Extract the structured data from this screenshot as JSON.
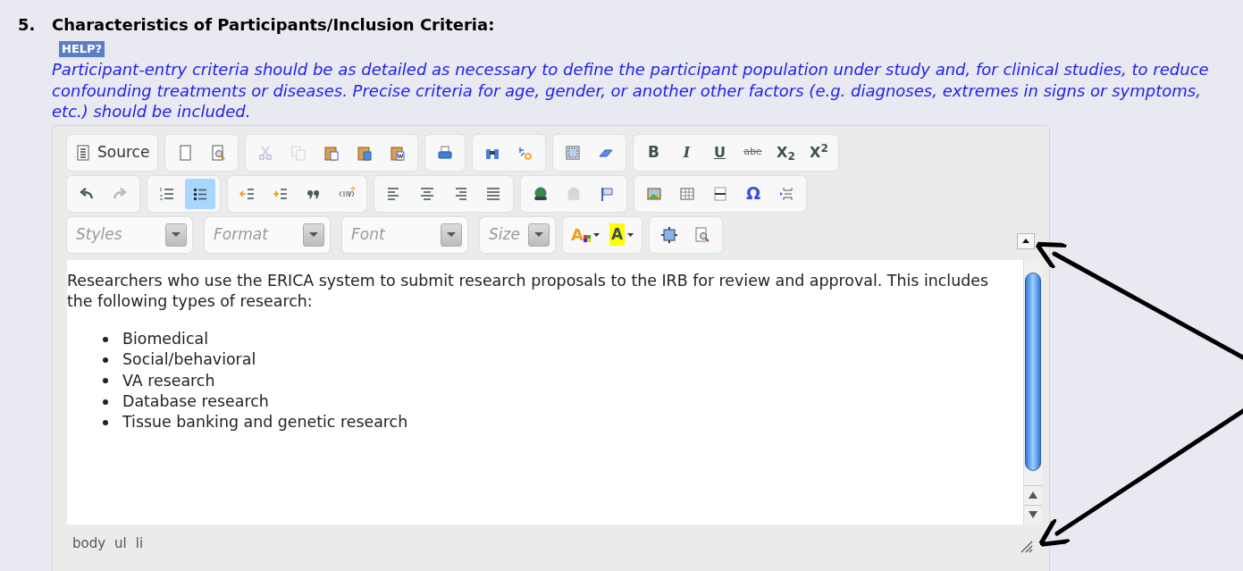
{
  "question": {
    "number": "5.",
    "title": "Characteristics of Participants/Inclusion Criteria:",
    "help": "HELP?",
    "instructions": "Participant-entry criteria should be as detailed as necessary to define the participant population under study and, for clinical studies, to reduce confounding treatments or diseases. Precise criteria for age, gender, or another other factors (e.g. diagnoses, extremes in signs or symptoms, etc.) should be included."
  },
  "editor": {
    "toolbar": [
      [
        [
          {
            "kind": "source",
            "label": "Source",
            "disabled": false,
            "selected": false
          }
        ],
        [
          {
            "kind": "newpage",
            "disabled": false,
            "selected": false
          },
          {
            "kind": "preview",
            "disabled": false,
            "selected": false
          }
        ],
        [
          {
            "kind": "cut",
            "disabled": true,
            "selected": false
          },
          {
            "kind": "copy",
            "disabled": true,
            "selected": false
          },
          {
            "kind": "paste",
            "disabled": false,
            "selected": false
          },
          {
            "kind": "pastetext",
            "disabled": false,
            "selected": false
          },
          {
            "kind": "pasteword",
            "disabled": false,
            "selected": false
          }
        ],
        [
          {
            "kind": "print",
            "disabled": false,
            "selected": false
          }
        ],
        [
          {
            "kind": "find",
            "disabled": false,
            "selected": false
          },
          {
            "kind": "replace",
            "disabled": false,
            "selected": false
          }
        ],
        [
          {
            "kind": "selectall",
            "disabled": false,
            "selected": false
          },
          {
            "kind": "eraser",
            "disabled": false,
            "selected": false
          }
        ],
        [
          {
            "kind": "bold",
            "label": "B",
            "disabled": false,
            "selected": false
          },
          {
            "kind": "italic",
            "label": "I",
            "disabled": false,
            "selected": false
          },
          {
            "kind": "underline",
            "label": "U",
            "disabled": false,
            "selected": false
          },
          {
            "kind": "strike",
            "label": "abe",
            "disabled": false,
            "selected": false
          },
          {
            "kind": "subscript",
            "label": "X$_{2}$",
            "disabled": false,
            "selected": false
          },
          {
            "kind": "superscript",
            "label": "X$^{2}$",
            "disabled": false,
            "selected": false
          }
        ]
      ],
      [
        [
          {
            "kind": "undo",
            "disabled": false,
            "selected": false
          },
          {
            "kind": "redo",
            "disabled": true,
            "selected": false
          }
        ],
        [
          {
            "kind": "numbered",
            "disabled": false,
            "selected": false
          },
          {
            "kind": "bulleted",
            "disabled": false,
            "selected": true
          }
        ],
        [
          {
            "kind": "outdent",
            "disabled": false,
            "selected": false
          },
          {
            "kind": "indent",
            "disabled": false,
            "selected": false
          },
          {
            "kind": "quote",
            "disabled": false,
            "selected": false
          },
          {
            "kind": "div",
            "disabled": false,
            "selected": false
          }
        ],
        [
          {
            "kind": "alignleft",
            "disabled": false,
            "selected": false
          },
          {
            "kind": "aligncenter",
            "disabled": false,
            "selected": false
          },
          {
            "kind": "alignright",
            "disabled": false,
            "selected": false
          },
          {
            "kind": "justify",
            "disabled": false,
            "selected": false
          }
        ],
        [
          {
            "kind": "link",
            "disabled": false,
            "selected": false
          },
          {
            "kind": "unlink",
            "disabled": true,
            "selected": false
          },
          {
            "kind": "anchor",
            "disabled": false,
            "selected": false
          }
        ],
        [
          {
            "kind": "image",
            "disabled": false,
            "selected": false
          },
          {
            "kind": "table",
            "disabled": false,
            "selected": false
          },
          {
            "kind": "hrule",
            "disabled": false,
            "selected": false
          },
          {
            "kind": "special",
            "label": "Ω",
            "disabled": false,
            "selected": false
          },
          {
            "kind": "pagebreak",
            "disabled": false,
            "selected": false
          }
        ]
      ],
      [
        [
          {
            "kind": "combo",
            "placeholder": "Styles"
          }
        ],
        [
          {
            "kind": "combo",
            "placeholder": "Format"
          }
        ],
        [
          {
            "kind": "combo",
            "placeholder": "Font"
          }
        ],
        [
          {
            "kind": "small-combo",
            "placeholder": "Size"
          }
        ],
        [
          {
            "kind": "textcolor",
            "label": "A",
            "disabled": false,
            "selected": false
          },
          {
            "kind": "bgcolor",
            "label": "A",
            "disabled": false,
            "selected": false
          }
        ],
        [
          {
            "kind": "maximize",
            "disabled": false,
            "selected": false
          },
          {
            "kind": "showblocks",
            "disabled": false,
            "selected": false
          }
        ]
      ]
    ],
    "content": {
      "paragraph": "Researchers who use the ERICA system to submit research proposals to the IRB for review and approval.  This includes the following types of research:",
      "bullets": [
        "Biomedical",
        "Social/behavioral",
        "VA research",
        "Database research",
        "Tissue banking and genetic research"
      ]
    },
    "path": [
      "body",
      "ul",
      "li"
    ]
  }
}
